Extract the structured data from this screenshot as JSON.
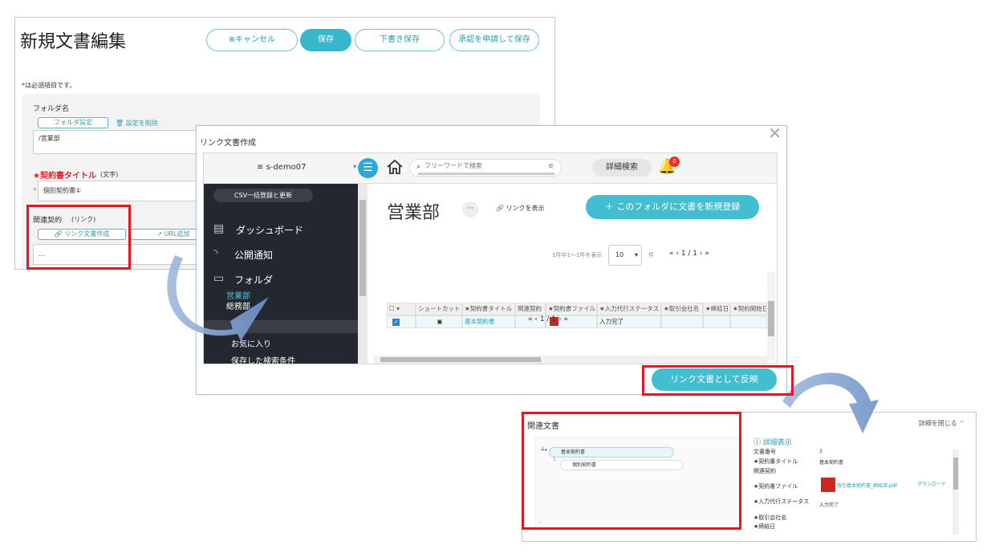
{
  "edit_form": {
    "title": "新規文書編集",
    "buttons": {
      "cancel": "⊗キャンセル",
      "save": "保存",
      "draft": "下書き保存",
      "request_approval": "承認を申請して保存"
    },
    "required_note": "*は必須項目です。",
    "folder_label": "フォルダ名",
    "folder_setting": "フォルダ設定",
    "remove_setting": "設定を削除",
    "folder_value": "/営業部",
    "contract_title_label": "★契約書タイトル",
    "contract_title_type": "(文字)",
    "contract_title_value": "個別契約書①",
    "related_label": "関連契約",
    "related_type": "(リンク)",
    "create_link": "リンク文書作成",
    "add_url": "URL追加",
    "related_value": "..."
  },
  "dialog": {
    "title": "リンク文書作成",
    "close": "✕",
    "tenant": "s-demo07",
    "search_placeholder": "フリーワードで検索",
    "advanced_search": "詳細検索",
    "notification_count": "0",
    "csv_button": "CSV一括登録と更新",
    "nav": {
      "dashboard": "ダッシュボード",
      "notice": "公開通知",
      "folder": "フォルダ",
      "sub_sales": "営業部",
      "sub_general": "総務部",
      "favorites": "お気に入り",
      "saved_search": "保存した検索条件"
    },
    "folder_title": "営業部",
    "more": "···",
    "show_link": "リンクを表示",
    "new_doc_button": "＋ このフォルダに文書を新規登録",
    "count_text": "1件中1〜1件を表示",
    "per_page": "10",
    "per_page_unit": "件",
    "pager_top": "«  ‹  1 / 1  ›  »",
    "pager_bottom": "«  ‹  1 / 1  ›  »",
    "columns": [
      "ショートカット",
      "★契約書タイトル",
      "関連契約",
      "★契約書ファイル",
      "★入力代行ステータス",
      "★取引会社名",
      "★締結日",
      "★契約開始日"
    ],
    "row": {
      "title": "基本契約書",
      "status": "入力完了"
    },
    "reflect_button": "リンク文書として反映"
  },
  "related_panel": {
    "title": "関連文書",
    "close_details": "詳細を閉じる",
    "tree": {
      "parent": "基本契約書",
      "child": "個別契約書"
    },
    "details_header": "詳細表示",
    "rows": [
      {
        "label": "文書番号",
        "value": "3"
      },
      {
        "label": "★契約書タイトル",
        "value": "基本契約書"
      },
      {
        "label": "関連契約",
        "value": ""
      },
      {
        "label": "★契約書ファイル",
        "value": "取引基本契約書_締結済.pdf"
      },
      {
        "label": "★入力代行ステータス",
        "value": "入力完了"
      },
      {
        "label": "★取引会社名",
        "value": ""
      },
      {
        "label": "★締結日",
        "value": ""
      }
    ],
    "download": "ダウンロード"
  }
}
